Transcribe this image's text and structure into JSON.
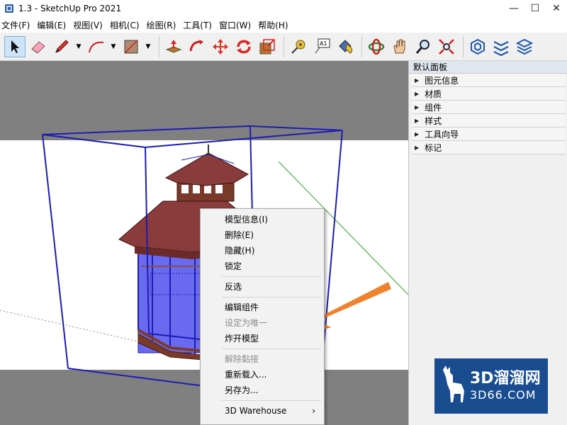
{
  "window": {
    "title": "1.3 - SketchUp Pro 2021",
    "minimize": "—",
    "restore": "☐",
    "close": "✕"
  },
  "menubar": [
    {
      "id": "file",
      "label": "文件(F)"
    },
    {
      "id": "edit",
      "label": "编辑(E)"
    },
    {
      "id": "view",
      "label": "视图(V)"
    },
    {
      "id": "camera",
      "label": "相机(C)"
    },
    {
      "id": "draw",
      "label": "绘图(R)"
    },
    {
      "id": "tools",
      "label": "工具(T)"
    },
    {
      "id": "window",
      "label": "窗口(W)"
    },
    {
      "id": "help",
      "label": "帮助(H)"
    }
  ],
  "toolbar": {
    "icons": [
      "select-icon",
      "eraser-icon",
      "pencil-line-icon",
      "arc-icon",
      "rectangle-icon",
      "push-pull-icon",
      "follow-me-icon",
      "move-icon",
      "rotate-icon",
      "scale-icon",
      "tape-measure-icon",
      "text-label-icon",
      "paint-bucket-icon",
      "orbit-icon",
      "pan-icon",
      "zoom-icon",
      "zoom-extents-icon",
      "warehouse-icon",
      "extension-icon",
      "layers-icon"
    ],
    "text_icon_label": "A1",
    "active_tool": "select"
  },
  "tray": {
    "title": "默认面板",
    "sections": [
      {
        "label": "图元信息"
      },
      {
        "label": "材质"
      },
      {
        "label": "组件"
      },
      {
        "label": "样式"
      },
      {
        "label": "工具向导"
      },
      {
        "label": "标记"
      }
    ]
  },
  "context_menu": {
    "items": [
      {
        "label": "模型信息(I)",
        "enabled": true
      },
      {
        "label": "删除(E)",
        "enabled": true
      },
      {
        "label": "隐藏(H)",
        "enabled": true
      },
      {
        "label": "锁定",
        "enabled": true
      },
      {
        "separator": true
      },
      {
        "label": "反选",
        "enabled": true
      },
      {
        "separator": true
      },
      {
        "label": "编辑组件",
        "enabled": true
      },
      {
        "label": "设定为唯一",
        "enabled": false
      },
      {
        "label": "炸开模型",
        "enabled": true
      },
      {
        "separator": true
      },
      {
        "label": "解除黏接",
        "enabled": false
      },
      {
        "label": "重新载入...",
        "enabled": true
      },
      {
        "label": "另存为...",
        "enabled": true
      },
      {
        "separator": true
      },
      {
        "label": "3D Warehouse",
        "enabled": true,
        "submenu": true
      }
    ]
  },
  "watermark": {
    "line1": "3D溜溜网",
    "line2": "3D66.COM"
  },
  "colors": {
    "viewport_bg": "#808080",
    "ground_white": "#ffffff",
    "bounding_box": "#1c1cb4",
    "roof": "#8a3b3b",
    "arrow": "#f0822d",
    "watermark_bg": "#1a4d8f"
  }
}
